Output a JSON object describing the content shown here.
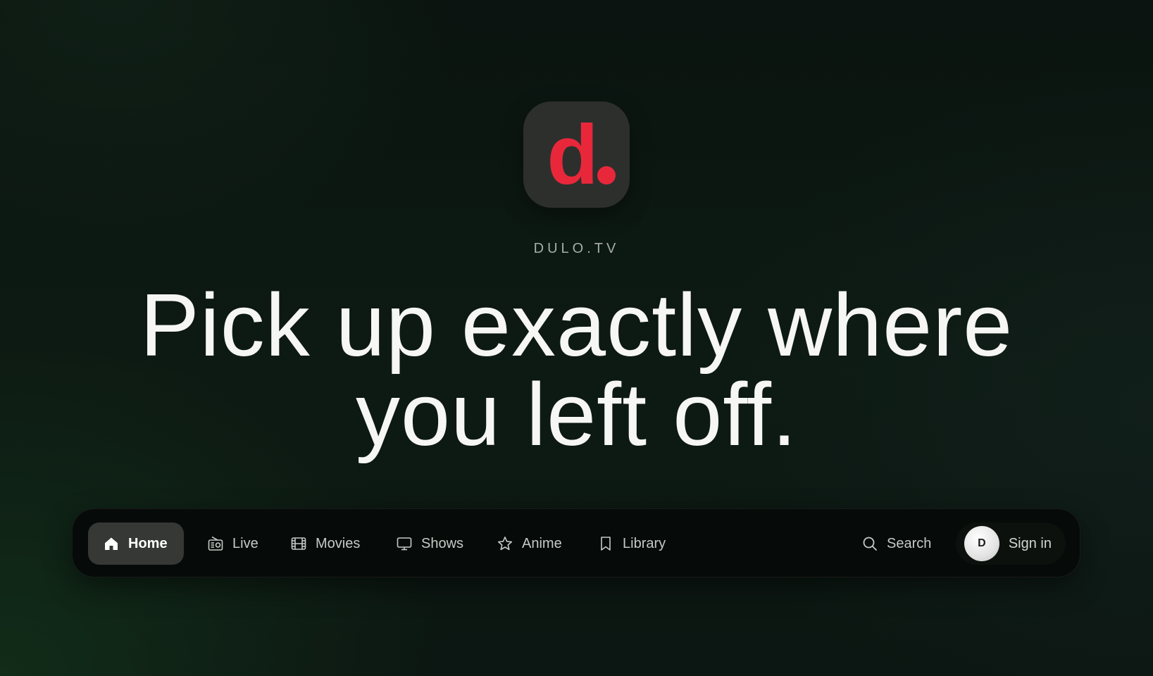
{
  "brand": {
    "name": "DULO.TV",
    "logo_letter": "d",
    "logo_color": "#e8283a",
    "logo_tile_color": "#2d2f2d"
  },
  "hero": {
    "line1": "Pick up exactly where",
    "line2": "you left off."
  },
  "nav": {
    "items": [
      {
        "label": "Home",
        "icon": "home-icon",
        "active": true
      },
      {
        "label": "Live",
        "icon": "radio-icon",
        "active": false
      },
      {
        "label": "Movies",
        "icon": "film-icon",
        "active": false
      },
      {
        "label": "Shows",
        "icon": "tv-icon",
        "active": false
      },
      {
        "label": "Anime",
        "icon": "star-icon",
        "active": false
      },
      {
        "label": "Library",
        "icon": "bookmark-icon",
        "active": false
      }
    ],
    "search_label": "Search",
    "signin_label": "Sign in",
    "avatar_initial": "D"
  },
  "colors": {
    "accent": "#e8283a",
    "active_tab": "#353835",
    "text": "#f6f6f4"
  }
}
